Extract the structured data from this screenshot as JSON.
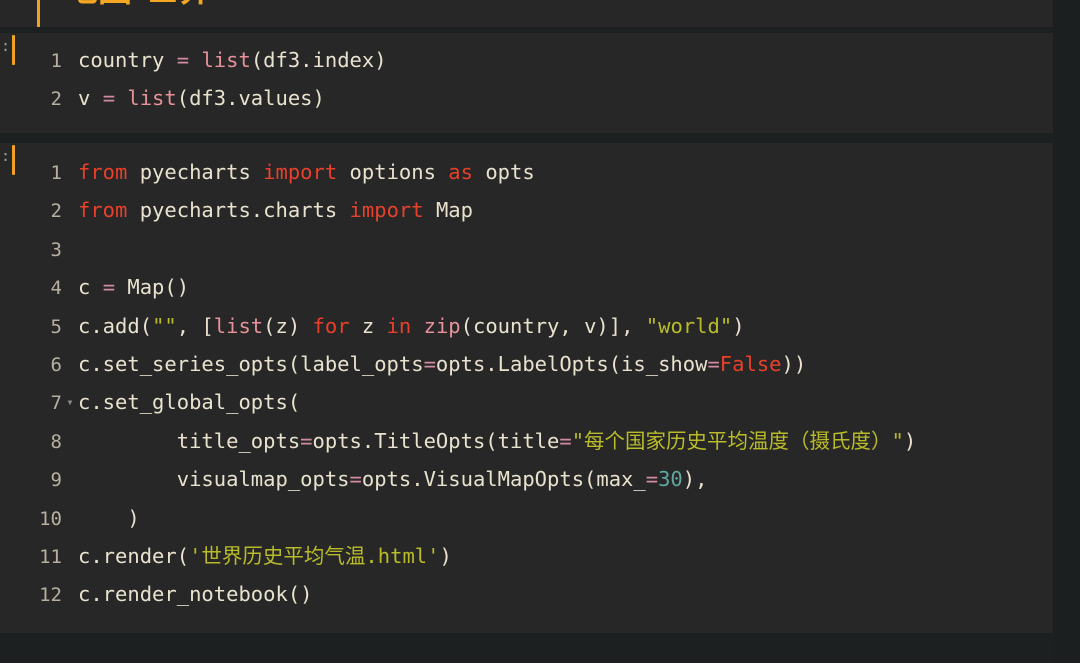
{
  "app": {
    "theme": "dark",
    "background": "#1c1f20",
    "cell_background": "#272727"
  },
  "colors": {
    "text": "#e8e2ce",
    "keyword": "#e8402a",
    "builtin": "#e7929a",
    "string": "#b9bb28",
    "number": "#5fa8a0",
    "operator": "#d08ba0",
    "line_number": "#b7b0a0",
    "active_cell_bar": "#f0a125",
    "markdown_heading": "#f5a623"
  },
  "markdown_cell": {
    "prompt": "",
    "heading_text": "地图 世界",
    "note": "clipped at top edge of screenshot"
  },
  "code_cell_1": {
    "prompt": ":",
    "lines": [
      {
        "number": "1",
        "fold": "",
        "text": "country = list(df3.index)"
      },
      {
        "number": "2",
        "fold": "",
        "text": "v = list(df3.values)"
      }
    ]
  },
  "code_cell_2": {
    "prompt": ":",
    "lines": [
      {
        "number": "1",
        "fold": "",
        "text": "from pyecharts import options as opts"
      },
      {
        "number": "2",
        "fold": "",
        "text": "from pyecharts.charts import Map"
      },
      {
        "number": "3",
        "fold": "",
        "text": ""
      },
      {
        "number": "4",
        "fold": "",
        "text": "c = Map()"
      },
      {
        "number": "5",
        "fold": "",
        "text": "c.add(\"\", [list(z) for z in zip(country, v)], \"world\")"
      },
      {
        "number": "6",
        "fold": "",
        "text": "c.set_series_opts(label_opts=opts.LabelOpts(is_show=False))"
      },
      {
        "number": "7",
        "fold": "▾",
        "text": "c.set_global_opts("
      },
      {
        "number": "8",
        "fold": "",
        "text": "        title_opts=opts.TitleOpts(title=\"每个国家历史平均温度（摄氏度）\")"
      },
      {
        "number": "9",
        "fold": "",
        "text": "        visualmap_opts=opts.VisualMapOpts(max_=30),"
      },
      {
        "number": "10",
        "fold": "",
        "text": "    )"
      },
      {
        "number": "11",
        "fold": "",
        "text": "c.render('世界历史平均气温.html')"
      },
      {
        "number": "12",
        "fold": "",
        "text": "c.render_notebook()"
      }
    ]
  },
  "tokens": {
    "c1_l1": [
      {
        "t": "country ",
        "c": "p"
      },
      {
        "t": "=",
        "c": "o"
      },
      {
        "t": " ",
        "c": "p"
      },
      {
        "t": "list",
        "c": "b"
      },
      {
        "t": "(df3.index)",
        "c": "p"
      }
    ],
    "c1_l2": [
      {
        "t": "v ",
        "c": "p"
      },
      {
        "t": "=",
        "c": "o"
      },
      {
        "t": " ",
        "c": "p"
      },
      {
        "t": "list",
        "c": "b"
      },
      {
        "t": "(df3.values)",
        "c": "p"
      }
    ],
    "c2_l1": [
      {
        "t": "from",
        "c": "k"
      },
      {
        "t": " pyecharts ",
        "c": "p"
      },
      {
        "t": "import",
        "c": "k"
      },
      {
        "t": " options ",
        "c": "p"
      },
      {
        "t": "as",
        "c": "k"
      },
      {
        "t": " opts",
        "c": "p"
      }
    ],
    "c2_l2": [
      {
        "t": "from",
        "c": "k"
      },
      {
        "t": " pyecharts.charts ",
        "c": "p"
      },
      {
        "t": "import",
        "c": "k"
      },
      {
        "t": " Map",
        "c": "p"
      }
    ],
    "c2_l3": [],
    "c2_l4": [
      {
        "t": "c ",
        "c": "p"
      },
      {
        "t": "=",
        "c": "o"
      },
      {
        "t": " Map()",
        "c": "p"
      }
    ],
    "c2_l5": [
      {
        "t": "c.add(",
        "c": "p"
      },
      {
        "t": "\"\"",
        "c": "s"
      },
      {
        "t": ", [",
        "c": "p"
      },
      {
        "t": "list",
        "c": "b"
      },
      {
        "t": "(z) ",
        "c": "p"
      },
      {
        "t": "for",
        "c": "k"
      },
      {
        "t": " z ",
        "c": "p"
      },
      {
        "t": "in",
        "c": "k"
      },
      {
        "t": " ",
        "c": "p"
      },
      {
        "t": "zip",
        "c": "b"
      },
      {
        "t": "(country, v)], ",
        "c": "p"
      },
      {
        "t": "\"world\"",
        "c": "s"
      },
      {
        "t": ")",
        "c": "p"
      }
    ],
    "c2_l6": [
      {
        "t": "c.set_series_opts(label_opts",
        "c": "p"
      },
      {
        "t": "=",
        "c": "o"
      },
      {
        "t": "opts.LabelOpts(is_show",
        "c": "p"
      },
      {
        "t": "=",
        "c": "o"
      },
      {
        "t": "False",
        "c": "c"
      },
      {
        "t": "))",
        "c": "p"
      }
    ],
    "c2_l7": [
      {
        "t": "c.set_global_opts(",
        "c": "p"
      }
    ],
    "c2_l8": [
      {
        "t": "        title_opts",
        "c": "p"
      },
      {
        "t": "=",
        "c": "o"
      },
      {
        "t": "opts.TitleOpts(title",
        "c": "p"
      },
      {
        "t": "=",
        "c": "o"
      },
      {
        "t": "\"每个国家历史平均温度（摄氏度）\"",
        "c": "s"
      },
      {
        "t": ")",
        "c": "p"
      }
    ],
    "c2_l9": [
      {
        "t": "        visualmap_opts",
        "c": "p"
      },
      {
        "t": "=",
        "c": "o"
      },
      {
        "t": "opts.VisualMapOpts(max_",
        "c": "p"
      },
      {
        "t": "=",
        "c": "o"
      },
      {
        "t": "30",
        "c": "n"
      },
      {
        "t": "),",
        "c": "p"
      }
    ],
    "c2_l10": [
      {
        "t": "    )",
        "c": "p"
      }
    ],
    "c2_l11": [
      {
        "t": "c.render(",
        "c": "p"
      },
      {
        "t": "'世界历史平均气温.html'",
        "c": "s"
      },
      {
        "t": ")",
        "c": "p"
      }
    ],
    "c2_l12": [
      {
        "t": "c.render_notebook()",
        "c": "p"
      }
    ]
  }
}
